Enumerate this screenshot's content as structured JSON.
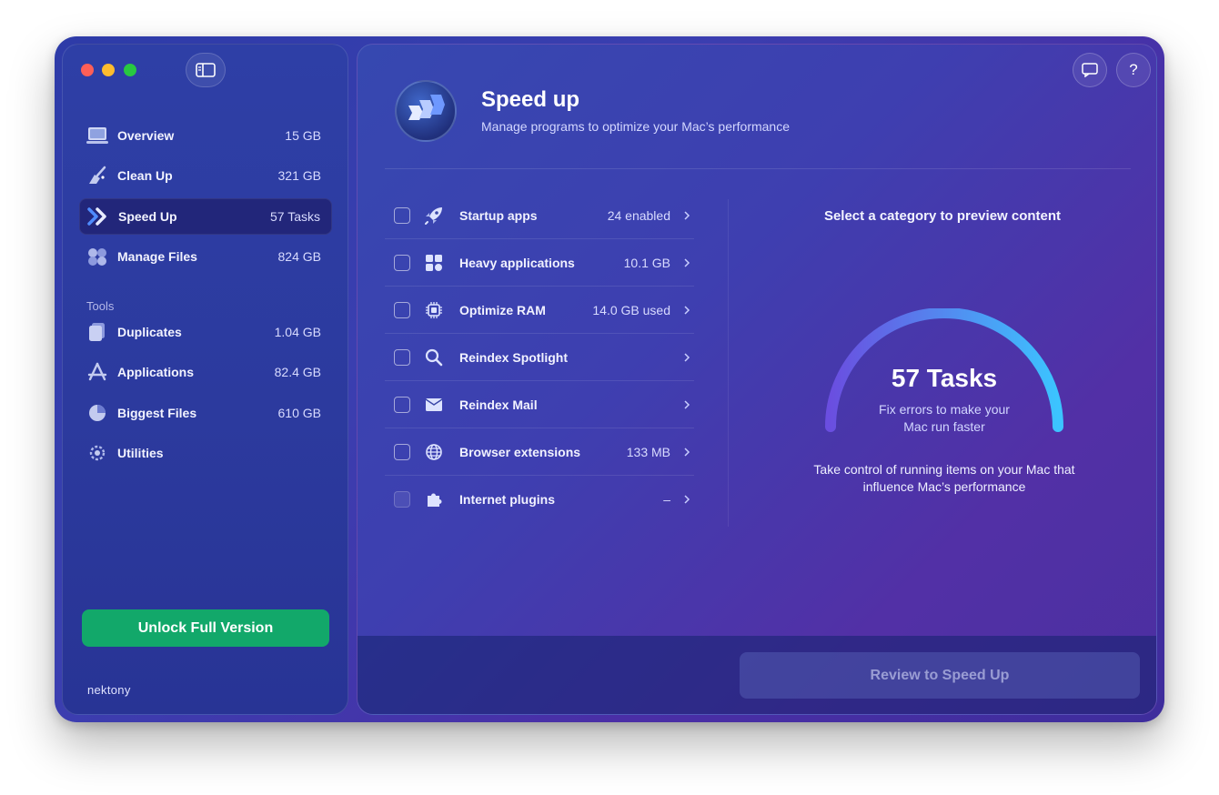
{
  "sidebar": {
    "items": [
      {
        "label": "Overview",
        "value": "15 GB",
        "icon": "laptop-icon"
      },
      {
        "label": "Clean Up",
        "value": "321 GB",
        "icon": "broom-icon"
      },
      {
        "label": "Speed Up",
        "value": "57 Tasks",
        "icon": "speed-arrows-icon"
      },
      {
        "label": "Manage Files",
        "value": "824 GB",
        "icon": "files-bubbles-icon"
      }
    ],
    "tools_label": "Tools",
    "tools": [
      {
        "label": "Duplicates",
        "value": "1.04 GB",
        "icon": "duplicates-icon"
      },
      {
        "label": "Applications",
        "value": "82.4 GB",
        "icon": "applications-icon"
      },
      {
        "label": "Biggest Files",
        "value": "610 GB",
        "icon": "pie-icon"
      },
      {
        "label": "Utilities",
        "value": "",
        "icon": "gear-icon"
      }
    ],
    "unlock_label": "Unlock Full Version",
    "brand": "nektony"
  },
  "header": {
    "title": "Speed up",
    "subtitle": "Manage programs to optimize your Mac’s performance",
    "chat_icon": "chat-icon",
    "help_label": "?"
  },
  "tasks": [
    {
      "label": "Startup apps",
      "value": "24 enabled",
      "icon": "rocket-icon"
    },
    {
      "label": "Heavy applications",
      "value": "10.1 GB",
      "icon": "grid-icon"
    },
    {
      "label": "Optimize RAM",
      "value": "14.0 GB used",
      "icon": "chip-icon"
    },
    {
      "label": "Reindex Spotlight",
      "value": "",
      "icon": "search-icon"
    },
    {
      "label": "Reindex Mail",
      "value": "",
      "icon": "mail-icon"
    },
    {
      "label": "Browser extensions",
      "value": "133 MB",
      "icon": "globe-icon"
    },
    {
      "label": "Internet plugins",
      "value": "–",
      "icon": "puzzle-icon"
    }
  ],
  "preview": {
    "title": "Select a category to preview content",
    "count": "57 Tasks",
    "count_desc": "Fix errors to make your Mac run faster",
    "desc": "Take control of running items on your Mac that influence Mac’s performance"
  },
  "footer": {
    "review_label": "Review to Speed Up"
  },
  "colors": {
    "accent_green": "#12a86a",
    "gauge_start": "#6a4ee0",
    "gauge_end": "#3cc4ff"
  }
}
